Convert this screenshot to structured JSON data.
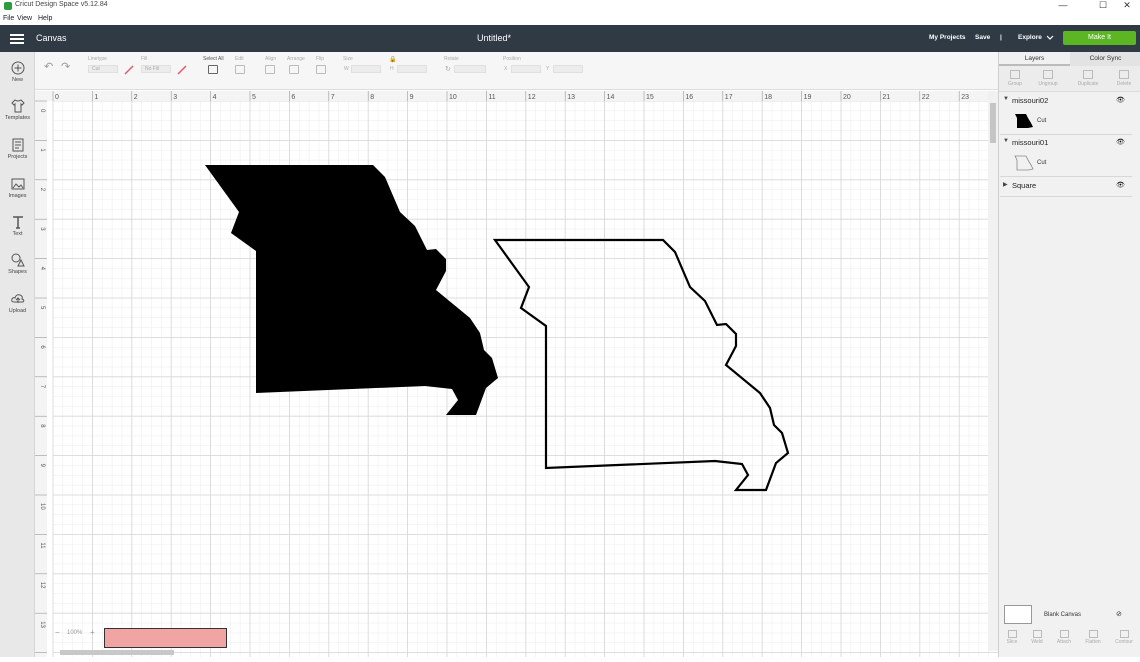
{
  "window": {
    "title": "Cricut Design Space  v5.12.84",
    "minimize": "—",
    "maximize": "☐",
    "close": "✕"
  },
  "menu": [
    "File",
    "View",
    "Help"
  ],
  "header": {
    "section": "Canvas",
    "document_title": "Untitled*",
    "my_projects": "My Projects",
    "save": "Save",
    "divider": "|",
    "explore": "Explore",
    "make_it": "Make It",
    "colors": {
      "bar": "#2f3a45",
      "make_it": "#5cb624"
    }
  },
  "left_tools": [
    {
      "label": "New",
      "icon": "plus-circle-icon"
    },
    {
      "label": "Templates",
      "icon": "tshirt-icon"
    },
    {
      "label": "Projects",
      "icon": "projects-icon"
    },
    {
      "label": "Images",
      "icon": "image-icon"
    },
    {
      "label": "Text",
      "icon": "text-icon"
    },
    {
      "label": "Shapes",
      "icon": "shapes-icon"
    },
    {
      "label": "Upload",
      "icon": "cloud-upload-icon"
    }
  ],
  "edit_bar": {
    "linetype_label": "Linetype",
    "linetype_value": "Cut",
    "fill_label": "Fill",
    "fill_value": "No Fill",
    "select_all": "Select All",
    "edit": "Edit",
    "align": "Align",
    "arrange": "Arrange",
    "flip": "Flip",
    "size": "Size",
    "size_w": "W",
    "size_h": "H",
    "rotate": "Rotate",
    "position": "Position",
    "position_x": "X",
    "position_y": "Y"
  },
  "rulers": {
    "horizontal": [
      "0",
      "1",
      "2",
      "3",
      "4",
      "5",
      "6",
      "7",
      "8",
      "9",
      "10",
      "11",
      "12",
      "13",
      "14",
      "15",
      "16",
      "17",
      "18",
      "19",
      "20",
      "21",
      "22",
      "23"
    ],
    "vertical": [
      "0",
      "1",
      "2",
      "3",
      "4",
      "5",
      "6",
      "7",
      "8",
      "9",
      "10",
      "11",
      "12",
      "13",
      "14"
    ]
  },
  "panel": {
    "tabs": [
      "Layers",
      "Color Sync"
    ],
    "tools": [
      "Group",
      "Ungroup",
      "Duplicate",
      "Delete"
    ],
    "layers": [
      {
        "name": "missouri02",
        "operation": "Cut",
        "style": "filled"
      },
      {
        "name": "missouri01",
        "operation": "Cut",
        "style": "outline"
      },
      {
        "name": "Square"
      }
    ],
    "blank_canvas": "Blank Canvas",
    "bottom_tools": [
      "Slice",
      "Weld",
      "Attach",
      "Flatten",
      "Contour"
    ]
  },
  "zoom": {
    "minus": "−",
    "level": "100%",
    "plus": "+"
  }
}
